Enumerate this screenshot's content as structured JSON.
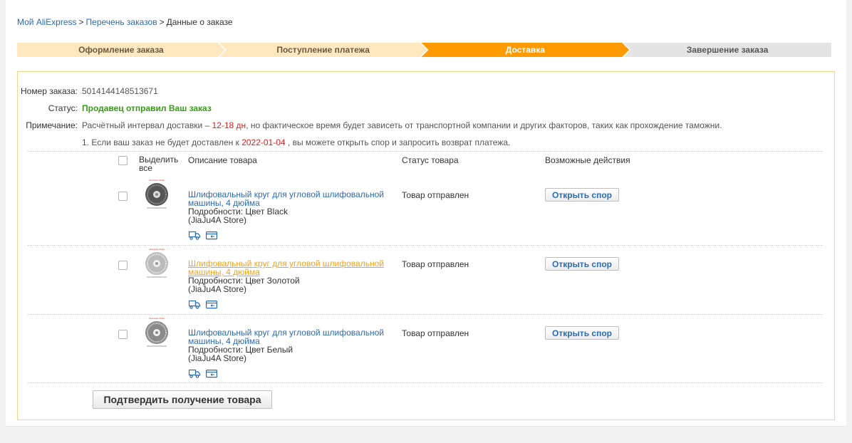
{
  "breadcrumb": {
    "items": [
      "Мой AliExpress",
      "Перечень заказов",
      "Данные о заказе"
    ],
    "separator": ">"
  },
  "steps": [
    {
      "label": "Оформление заказа",
      "state": "done"
    },
    {
      "label": "Поступление платежа",
      "state": "done"
    },
    {
      "label": "Доставка",
      "state": "active"
    },
    {
      "label": "Завершение заказа",
      "state": "todo"
    }
  ],
  "order": {
    "number_label": "Номер заказа:",
    "number": "5014144148513671",
    "status_label": "Статус:",
    "status": "Продавец отправил Ваш заказ",
    "note_label": "Примечание:",
    "note_prefix": "Расчётный интервал доставки – ",
    "note_days": "12-18 дн",
    "note_suffix": ", но фактическое время будет зависеть от транспортной компании и других факторов, таких как прохождение таможни.",
    "note2_prefix": "1. Если ваш заказ не будет доставлен к ",
    "note2_date": "2022-01-04",
    "note2_suffix": " , вы можете открыть спор и запросить возврат платежа."
  },
  "table": {
    "select_all": "Выделить все",
    "col_description": "Описание товара",
    "col_status": "Статус товара",
    "col_actions": "Возможные действия"
  },
  "items": [
    {
      "title": "Шлифовальный круг для угловой шлифовальной машины, 4 дюйма",
      "details": "Подробности: Цвет Black",
      "store": "(JiaJu4A Store)",
      "status": "Товар отправлен",
      "action": "Открыть спор"
    },
    {
      "title": "Шлифовальный круг для угловой шлифовальной машины, 4 дюйма",
      "details": "Подробности: Цвет Золотой",
      "store": "(JiaJu4A Store)",
      "status": "Товар отправлен",
      "action": "Открыть спор"
    },
    {
      "title": "Шлифовальный круг для угловой шлифовальной машины, 4 дюйма",
      "details": "Подробности: Цвет Белый",
      "store": "(JiaJu4A Store)",
      "status": "Товар отправлен",
      "action": "Открыть спор"
    }
  ],
  "confirm_button": "Подтвердить получение товара",
  "colors": {
    "link": "#2a6bb7",
    "active_step": "#ff9a00",
    "done_step": "#fde8bf",
    "status_green": "#3a9a1c",
    "highlight_red": "#e02020",
    "hover_orange": "#f7a21b"
  },
  "icons": [
    "truck-icon",
    "card-icon"
  ]
}
